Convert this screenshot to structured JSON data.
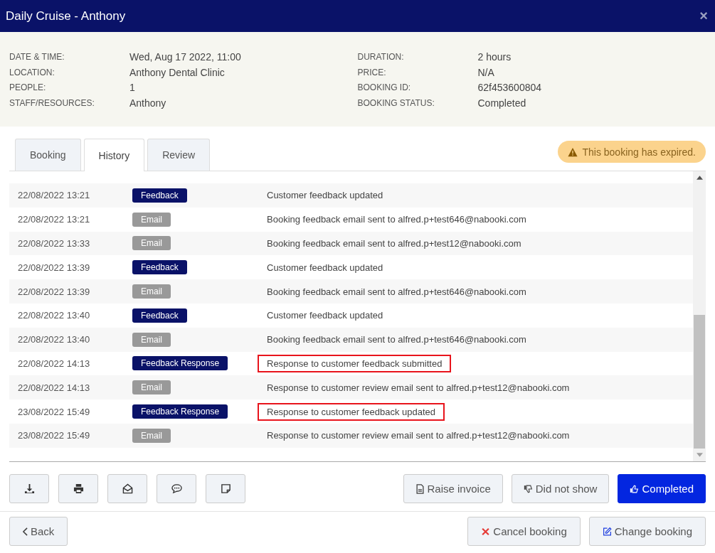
{
  "window": {
    "title": "Daily Cruise - Anthony",
    "close": "×"
  },
  "details_left": [
    {
      "label": "DATE & TIME:",
      "value": "Wed, Aug 17 2022, 11:00"
    },
    {
      "label": "LOCATION:",
      "value": "Anthony Dental Clinic"
    },
    {
      "label": "PEOPLE:",
      "value": "1"
    },
    {
      "label": "STAFF/RESOURCES:",
      "value": "Anthony"
    }
  ],
  "details_right": [
    {
      "label": "DURATION:",
      "value": "2 hours"
    },
    {
      "label": "PRICE:",
      "value": "N/A"
    },
    {
      "label": "BOOKING ID:",
      "value": "62f453600804"
    },
    {
      "label": "BOOKING STATUS:",
      "value": "Completed"
    }
  ],
  "tabs": [
    {
      "label": "Booking",
      "selected": false
    },
    {
      "label": "History",
      "selected": true
    },
    {
      "label": "Review",
      "selected": false
    }
  ],
  "alert": "This booking has expired.",
  "history": [
    {
      "time": "22/08/2022 13:21",
      "tag": "Feedback",
      "kind": "feedback",
      "text": "Customer feedback updated",
      "highlighted": false
    },
    {
      "time": "22/08/2022 13:21",
      "tag": "Email",
      "kind": "email",
      "text": "Booking feedback email sent to alfred.p+test646@nabooki.com",
      "highlighted": false
    },
    {
      "time": "22/08/2022 13:33",
      "tag": "Email",
      "kind": "email",
      "text": "Booking feedback email sent to alfred.p+test12@nabooki.com",
      "highlighted": false
    },
    {
      "time": "22/08/2022 13:39",
      "tag": "Feedback",
      "kind": "feedback",
      "text": "Customer feedback updated",
      "highlighted": false
    },
    {
      "time": "22/08/2022 13:39",
      "tag": "Email",
      "kind": "email",
      "text": "Booking feedback email sent to alfred.p+test646@nabooki.com",
      "highlighted": false
    },
    {
      "time": "22/08/2022 13:40",
      "tag": "Feedback",
      "kind": "feedback",
      "text": "Customer feedback updated",
      "highlighted": false
    },
    {
      "time": "22/08/2022 13:40",
      "tag": "Email",
      "kind": "email",
      "text": "Booking feedback email sent to alfred.p+test646@nabooki.com",
      "highlighted": false
    },
    {
      "time": "22/08/2022 14:13",
      "tag": "Feedback Response",
      "kind": "feedback",
      "text": "Response to customer feedback submitted",
      "highlighted": true
    },
    {
      "time": "22/08/2022 14:13",
      "tag": "Email",
      "kind": "email",
      "text": "Response to customer review email sent to alfred.p+test12@nabooki.com",
      "highlighted": false
    },
    {
      "time": "23/08/2022 15:49",
      "tag": "Feedback Response",
      "kind": "feedback",
      "text": "Response to customer feedback updated",
      "highlighted": true
    },
    {
      "time": "23/08/2022 15:49",
      "tag": "Email",
      "kind": "email",
      "text": "Response to customer review email sent to alfred.p+test12@nabooki.com",
      "highlighted": false
    }
  ],
  "toolbar_icons": [
    {
      "kind": "download"
    },
    {
      "kind": "print"
    },
    {
      "kind": "mail"
    },
    {
      "kind": "chat"
    },
    {
      "kind": "note"
    }
  ],
  "actions": [
    {
      "label": "Raise invoice",
      "kind": "invoice",
      "primary": false
    },
    {
      "label": "Did not show",
      "kind": "thumbs-down",
      "primary": false
    },
    {
      "label": "Completed",
      "kind": "thumbs-up",
      "primary": true
    }
  ],
  "back": "Back",
  "footer_actions": [
    {
      "label": "Cancel booking",
      "kind": "cancel"
    },
    {
      "label": "Change booking",
      "kind": "edit"
    }
  ]
}
